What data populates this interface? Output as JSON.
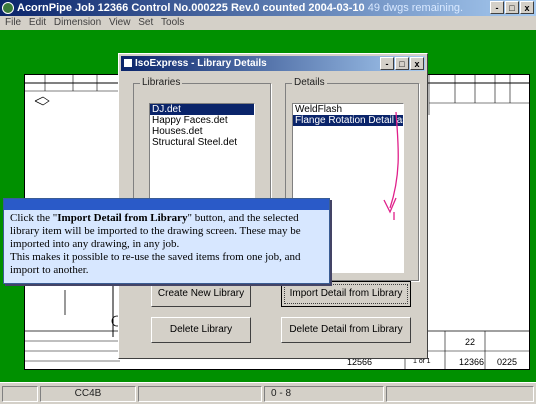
{
  "app": {
    "title_prefix": "AcornPipe Job 12366   Control No.000225 Rev.0 counted 2004-03-10 ",
    "title_count": "49 dwgs remaining.",
    "window_buttons": [
      "-",
      "□",
      "x"
    ]
  },
  "menu": [
    "File",
    "Edit",
    "Dimension",
    "View",
    "Set",
    "Tools"
  ],
  "dialog": {
    "title": "IsoExpress - Library Details",
    "libraries_label": "Libraries",
    "details_label": "Details",
    "libraries": [
      "DJ.det",
      "Happy Faces.det",
      "Houses.det",
      "Structural Steel.det"
    ],
    "libraries_selected": 0,
    "details": [
      "WeldFlash",
      "Flange Rotation Detail as shown"
    ],
    "details_selected": 1,
    "buttons": {
      "create_library": "Create New Library",
      "import_detail": "Import Detail from Library",
      "delete_library": "Delete Library",
      "delete_detail": "Delete Detail from Library"
    }
  },
  "tooltip": {
    "line1_pre": "Click the \"",
    "line1_bold": "Import Detail from Library",
    "line1_post": "\" button, and the selected library item will be imported to the drawing screen. These may be imported into any drawing, in any job.",
    "line2": "This makes it possible to re-use the saved items from one job, and import to another."
  },
  "drawing": {
    "right_block": [
      "22",
      "0225",
      "12366",
      "1 of 1",
      "12566"
    ]
  },
  "status": {
    "panel1": "CC4B",
    "panel2": "0 - 8"
  }
}
